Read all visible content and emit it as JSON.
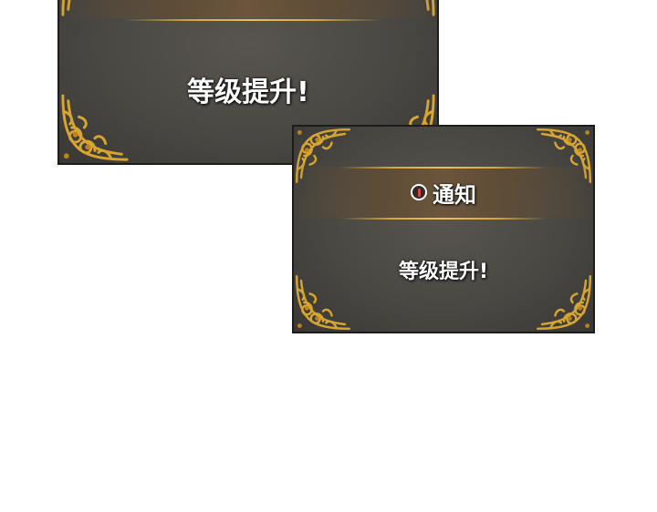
{
  "panels": [
    {
      "title": "",
      "message": "等级提升!"
    },
    {
      "title": "通知",
      "message": "等级提升!"
    }
  ],
  "icons": {
    "alert": "exclamation-circle-icon",
    "ornament": "gold-ornament-icon"
  },
  "colors": {
    "panel": "#4a4843",
    "gold": "#d6a63a",
    "text": "#ffffff",
    "alert": "#e04040"
  }
}
